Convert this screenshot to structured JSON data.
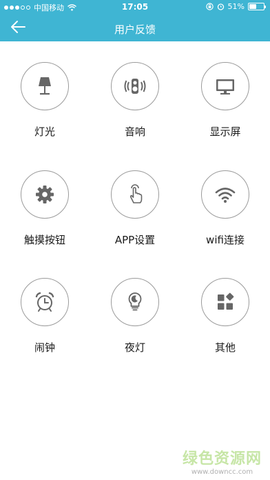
{
  "status_bar": {
    "carrier": "中国移动",
    "time": "17:05",
    "battery": "51%",
    "battery_level": 0.51
  },
  "nav": {
    "title": "用户反馈",
    "back_icon": "arrow-left-icon"
  },
  "items": [
    {
      "label": "灯光",
      "icon": "lamp-icon"
    },
    {
      "label": "音响",
      "icon": "speaker-icon"
    },
    {
      "label": "显示屏",
      "icon": "monitor-icon"
    },
    {
      "label": "触摸按钮",
      "icon": "gear-icon"
    },
    {
      "label": "APP设置",
      "icon": "touch-hand-icon"
    },
    {
      "label": "wifi连接",
      "icon": "wifi-icon"
    },
    {
      "label": "闹钟",
      "icon": "alarm-clock-icon"
    },
    {
      "label": "夜灯",
      "icon": "night-light-bulb-icon"
    },
    {
      "label": "其他",
      "icon": "grid-apps-icon"
    }
  ],
  "watermark": {
    "title": "绿色资源网",
    "url": "www.downcc.com"
  },
  "colors": {
    "header": "#3fb5d3",
    "icon": "#666666",
    "circle_border": "#9a9a9a"
  }
}
